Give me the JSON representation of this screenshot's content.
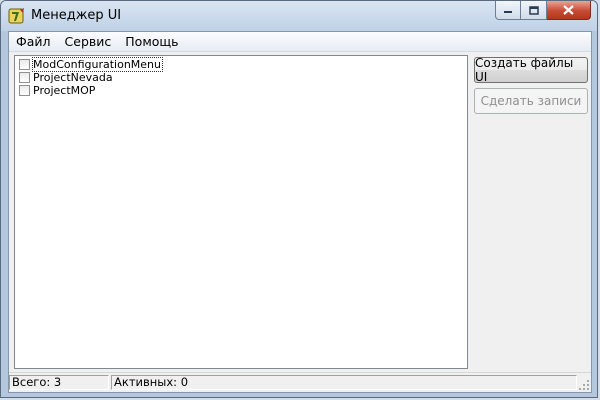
{
  "window": {
    "title": "Менеджер UI",
    "app_icon": "app-logo-icon"
  },
  "menu": {
    "items": [
      {
        "label": "Файл"
      },
      {
        "label": "Сервис"
      },
      {
        "label": "Помощь"
      }
    ]
  },
  "list": {
    "items": [
      {
        "label": "ModConfigurationMenu",
        "checked": false,
        "focused": true
      },
      {
        "label": "ProjectNevada",
        "checked": false,
        "focused": false
      },
      {
        "label": "ProjectMOP",
        "checked": false,
        "focused": false
      }
    ]
  },
  "buttons": {
    "create": {
      "label": "Создать файлы UI",
      "enabled": true
    },
    "make": {
      "label": "Сделать записи",
      "enabled": false
    }
  },
  "status": {
    "total": "Всего: 3",
    "active": "Активных: 0"
  }
}
